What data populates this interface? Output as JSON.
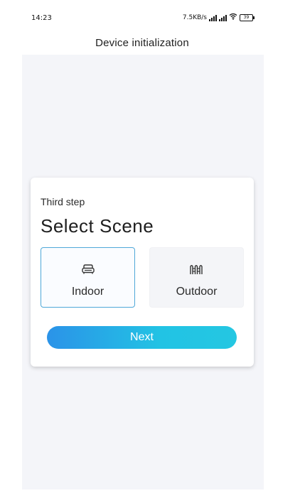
{
  "status_bar": {
    "time": "14:23",
    "network_speed": "7.5KB/s",
    "battery_level": "39",
    "icons": [
      "signal-icon",
      "signal-icon",
      "wifi-icon",
      "battery-icon"
    ]
  },
  "header": {
    "title": "Device initialization"
  },
  "card": {
    "step_label": "Third step",
    "title": "Select Scene",
    "options": [
      {
        "label": "Indoor",
        "icon": "sofa-icon",
        "selected": true
      },
      {
        "label": "Outdoor",
        "icon": "fence-icon",
        "selected": false
      }
    ],
    "next_label": "Next"
  },
  "colors": {
    "accent": "#2b93e8",
    "accent_end": "#24c7e2",
    "selected_border": "#4fa8d8",
    "background": "#f4f5f9"
  }
}
